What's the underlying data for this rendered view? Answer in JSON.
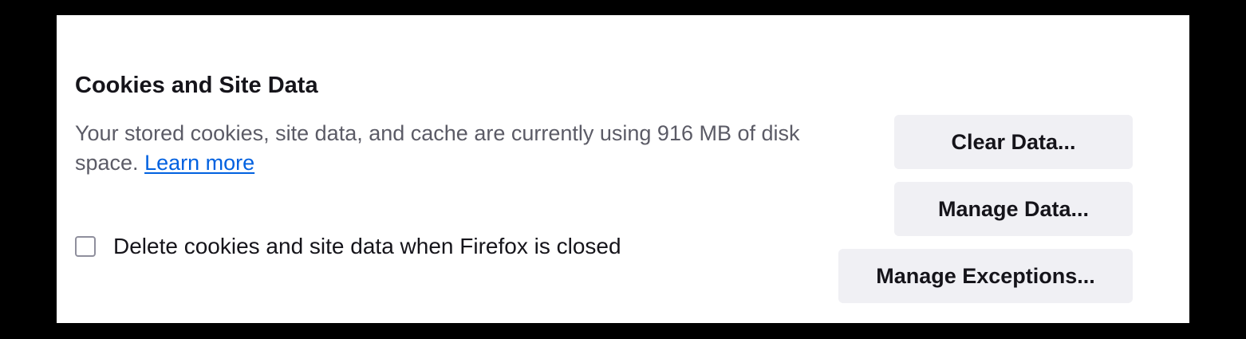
{
  "section": {
    "title": "Cookies and Site Data",
    "description_text": "Your stored cookies, site data, and cache are currently using 916 MB of disk space.",
    "learn_more_label": "Learn more"
  },
  "options": {
    "delete_on_close_label": "Delete cookies and site data when Firefox is closed",
    "delete_on_close_checked": false
  },
  "buttons": {
    "clear_data_label": "Clear Data...",
    "manage_data_label": "Manage Data...",
    "manage_exceptions_label": "Manage Exceptions..."
  }
}
